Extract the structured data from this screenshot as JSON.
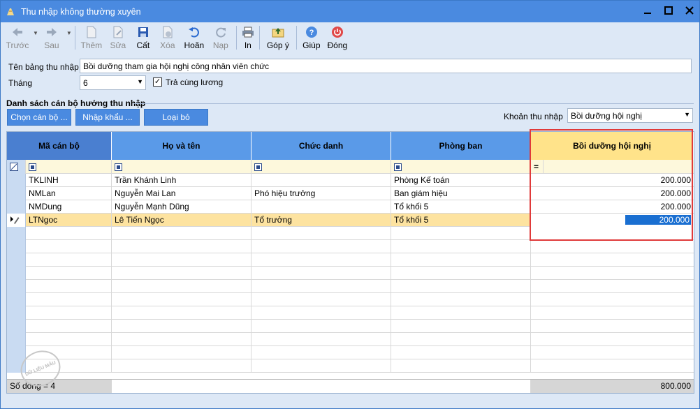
{
  "window": {
    "title": "Thu nhập không thường xuyên"
  },
  "toolbar": {
    "prev": "Trước",
    "next": "Sau",
    "add": "Thêm",
    "edit": "Sửa",
    "save": "Cất",
    "delete": "Xóa",
    "undo": "Hoãn",
    "load": "Nạp",
    "print": "In",
    "feedback": "Góp ý",
    "help": "Giúp",
    "close": "Đóng"
  },
  "form": {
    "name_label": "Tên bảng thu nhập",
    "name_value": "Bồi dưỡng tham gia hội nghị công nhân viên chức",
    "month_label": "Tháng",
    "month_value": "6",
    "pay_with_salary_label": "Trả cùng lương",
    "pay_with_salary_checked": true
  },
  "section": {
    "title": "Danh sách cán bộ hưởng thu nhập",
    "choose_staff": "Chọn cán bộ ...",
    "import": "Nhập khẩu ...",
    "remove": "Loại bỏ",
    "income_item_label": "Khoản thu nhập",
    "income_item_value": "Bồi dưỡng hội nghị"
  },
  "grid": {
    "headers": [
      "Mã cán bộ",
      "Họ và tên",
      "Chức danh",
      "Phòng ban",
      "Bồi dưỡng hội nghị"
    ],
    "amount_filter_op": "=",
    "rows": [
      {
        "code": "TKLINH",
        "name": "Trần Khánh Linh",
        "title": "",
        "dept": "Phòng Kế toán",
        "amount": "200.000"
      },
      {
        "code": "NMLan",
        "name": "Nguyễn Mai Lan",
        "title": "Phó hiệu trưởng",
        "dept": "Ban giám hiệu",
        "amount": "200.000"
      },
      {
        "code": "NMDung",
        "name": "Nguyễn Mạnh Dũng",
        "title": "",
        "dept": "Tổ khối 5",
        "amount": "200.000"
      },
      {
        "code": "LTNgoc",
        "name": "Lê Tiến Ngọc",
        "title": "Tổ trưởng",
        "dept": "Tổ khối 5",
        "amount": "200.000"
      }
    ],
    "row_count": "Số dòng = 4",
    "total": "800.000"
  },
  "watermark": "DỮ LIỆU MẪU"
}
